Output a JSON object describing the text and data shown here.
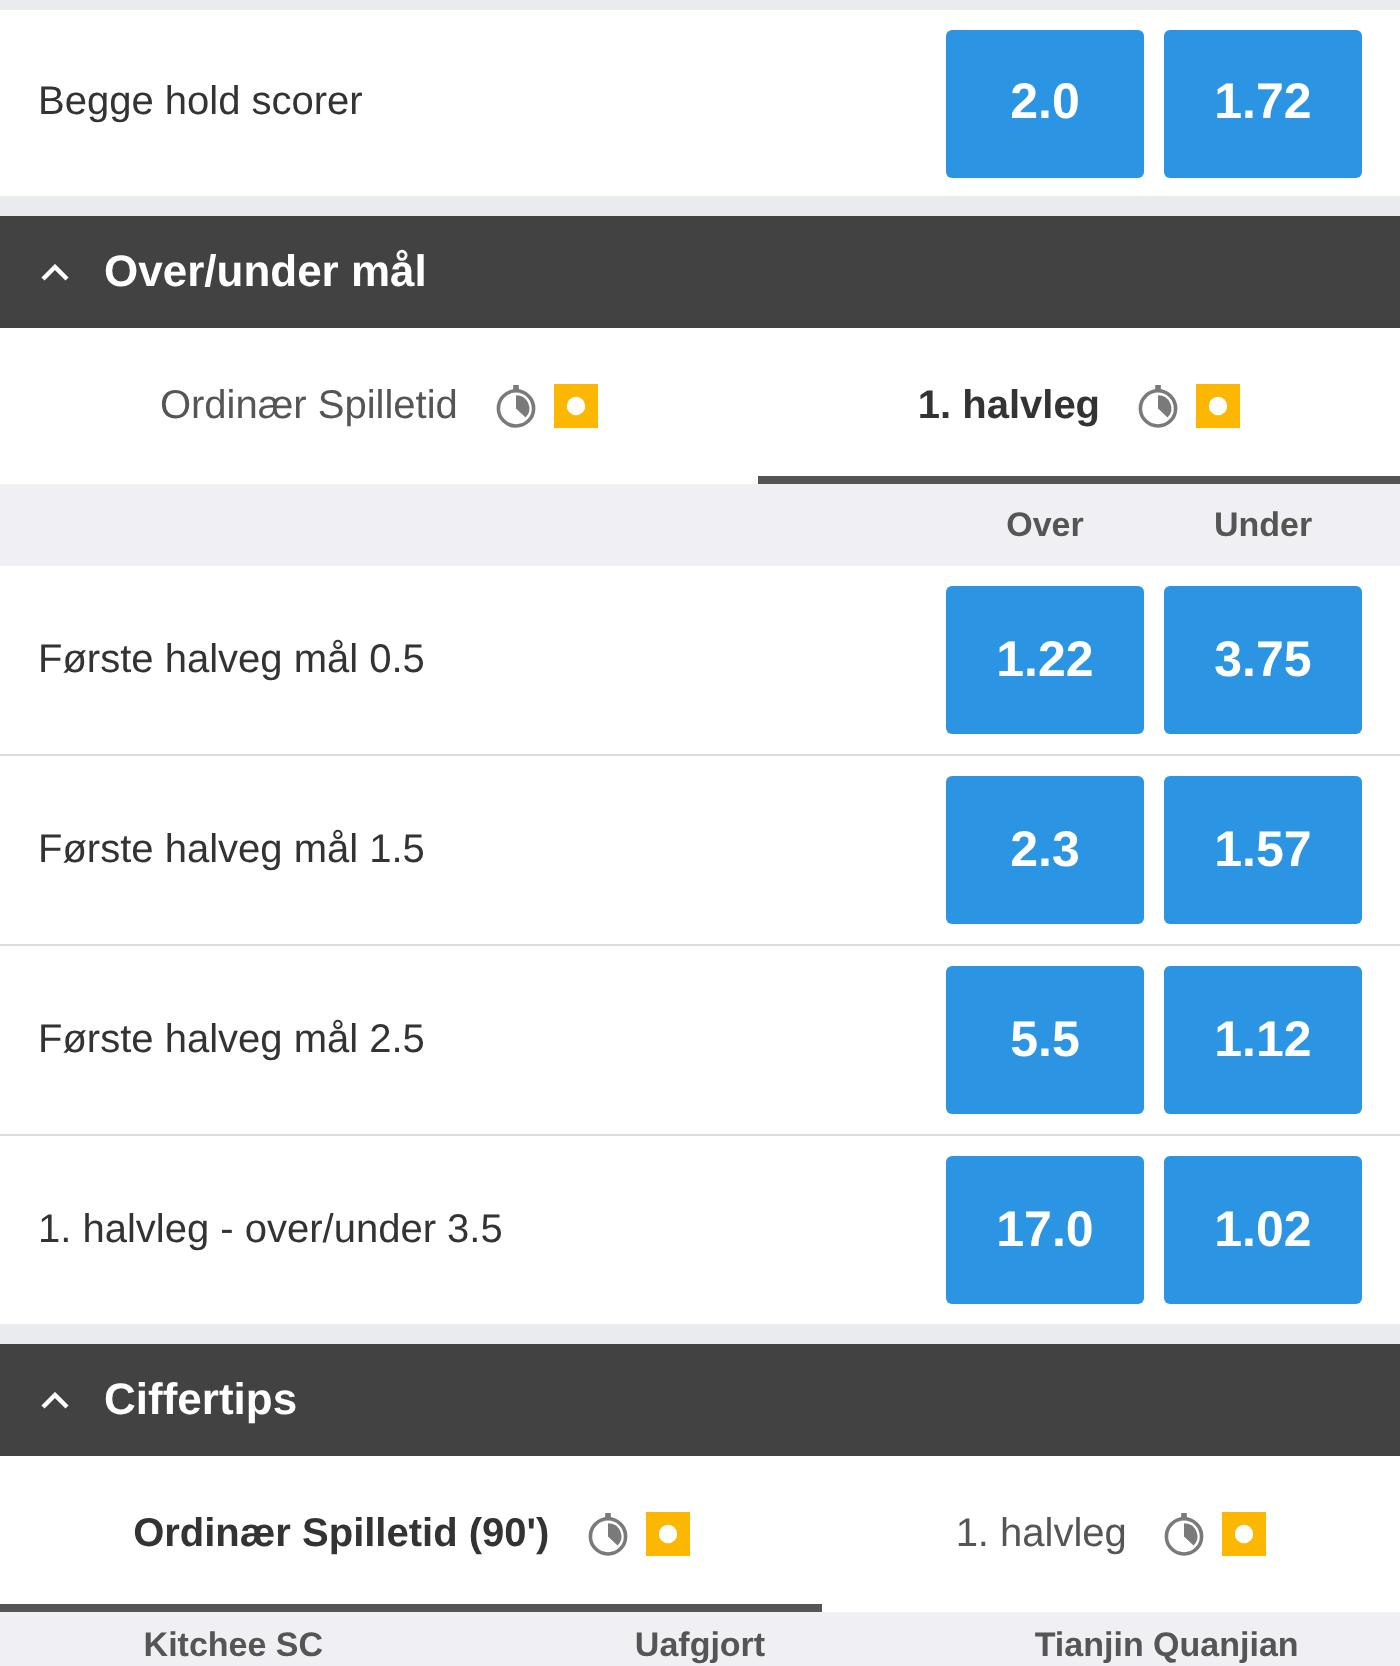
{
  "previous_section": {
    "rows": [
      {
        "label": "Begge hold scorer",
        "odds": [
          "2.0",
          "1.72"
        ]
      }
    ]
  },
  "sections": [
    {
      "title": "Over/under mål",
      "expanded": true,
      "tabs": [
        {
          "label": "Ordinær Spilletid",
          "selected": false
        },
        {
          "label": "1. halvleg",
          "selected": true
        }
      ],
      "columns": [
        "Over",
        "Under"
      ],
      "rows": [
        {
          "label": "Første halveg mål 0.5",
          "odds": [
            "1.22",
            "3.75"
          ]
        },
        {
          "label": "Første halveg mål 1.5",
          "odds": [
            "2.3",
            "1.57"
          ]
        },
        {
          "label": "Første halveg mål 2.5",
          "odds": [
            "5.5",
            "1.12"
          ]
        },
        {
          "label": "1. halvleg - over/under 3.5",
          "odds": [
            "17.0",
            "1.02"
          ]
        }
      ]
    },
    {
      "title": "Ciffertips",
      "expanded": true,
      "tabs": [
        {
          "label": "Ordinær Spilletid (90')",
          "selected": true
        },
        {
          "label": "1. halvleg",
          "selected": false
        }
      ],
      "columns": [
        "Kitchee SC",
        "Uafgjort",
        "Tianjin Quanjian"
      ]
    }
  ]
}
